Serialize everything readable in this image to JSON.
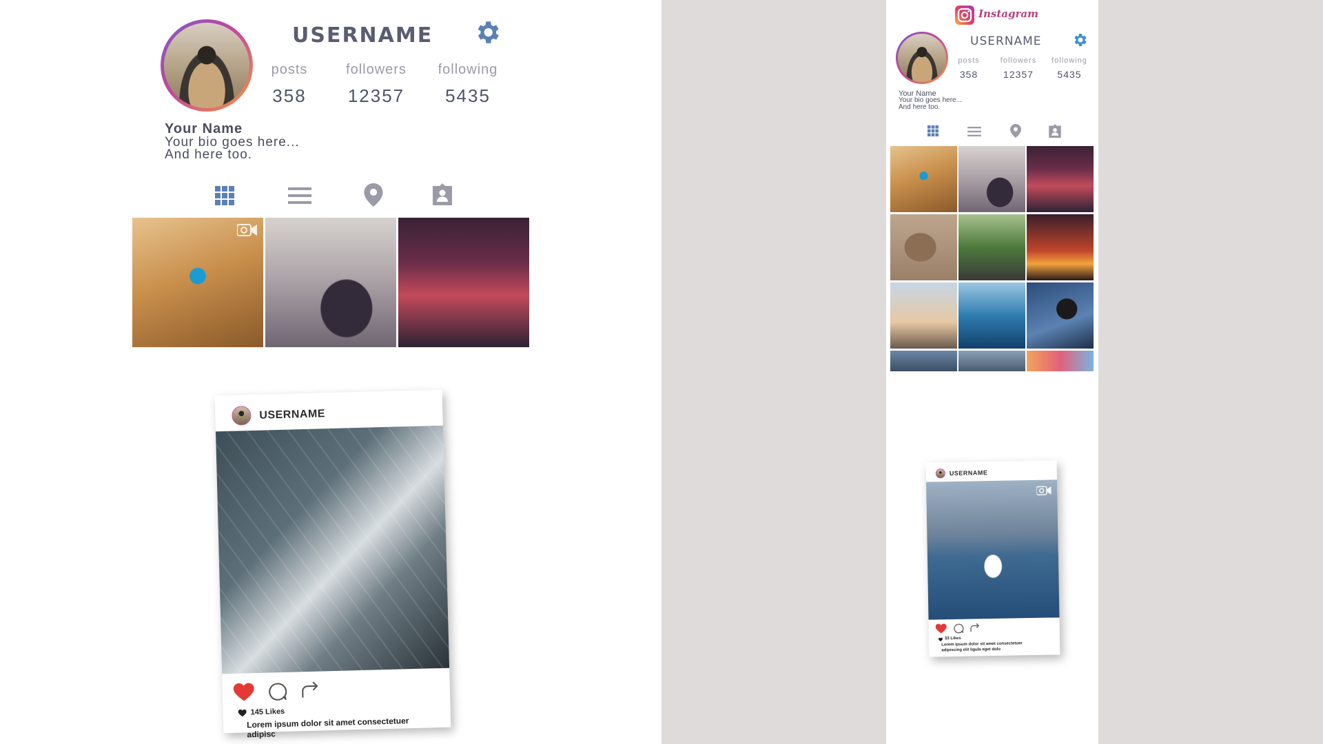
{
  "brand": {
    "name": "Instagram",
    "gradient": [
      "#f9b246",
      "#e4405f",
      "#9a3ec7"
    ]
  },
  "colors": {
    "background_band": "#e0dbdb",
    "accent_gear": "#5b80b5",
    "like_red": "#e53935",
    "icon_blue": "#5b80b5",
    "icon_gray": "#9b9aa8"
  },
  "profile_large": {
    "username": "USERNAME",
    "stats": [
      {
        "label": "posts",
        "value": "358"
      },
      {
        "label": "followers",
        "value": "12357"
      },
      {
        "label": "following",
        "value": "5435"
      }
    ],
    "name": "Your Name",
    "bio_line1": "Your bio goes here...",
    "bio_line2": "And here too.",
    "tabs": [
      "grid-icon",
      "list-icon",
      "location-pin-icon",
      "tagged-icon"
    ],
    "grid": [
      {
        "name": "bike-photo",
        "video": true
      },
      {
        "name": "luggage-photo",
        "video": false
      },
      {
        "name": "street-photo",
        "video": false
      }
    ]
  },
  "post_large": {
    "username": "USERNAME",
    "likes": "145 Likes",
    "caption_line1": "Lorem ipsum dolor sit amet consectetuer",
    "caption_line2": "adipisc"
  },
  "profile_small": {
    "username": "USERNAME",
    "stats": [
      {
        "label": "posts",
        "value": "358"
      },
      {
        "label": "followers",
        "value": "12357"
      },
      {
        "label": "following",
        "value": "5435"
      }
    ],
    "name": "Your Name",
    "bio_line1": "Your bio goes here...",
    "bio_line2": "And here too.",
    "tabs": [
      "grid-icon",
      "list-icon",
      "location-pin-icon",
      "tagged-icon"
    ]
  },
  "post_small": {
    "username": "USERNAME",
    "likes": "33 Likes",
    "caption_line1": "Lorem ipsum dolor sit amet consectetuer",
    "caption_line2": "adipiscing elit ligula eget dolo"
  }
}
